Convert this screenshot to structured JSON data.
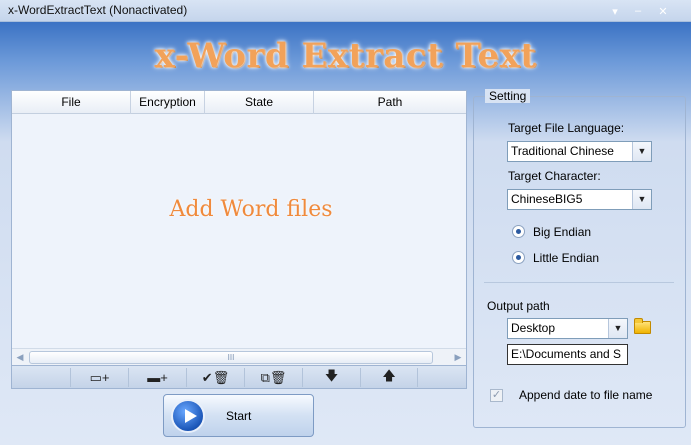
{
  "window": {
    "title": "x-WordExtractText",
    "activation": "(Nonactivated)"
  },
  "banner": "x-Word Extract Text",
  "file_list": {
    "columns": [
      "File",
      "Encryption",
      "State",
      "Path"
    ],
    "empty_hint": "Add Word files",
    "scroll_grip": "III"
  },
  "toolbar": {
    "buttons": [
      {
        "name": "add-file",
        "glyph": "▭+"
      },
      {
        "name": "add-folder",
        "glyph": "▬+"
      },
      {
        "name": "remove-checked",
        "glyph": "✔🗑"
      },
      {
        "name": "remove-all",
        "glyph": "⧉🗑"
      },
      {
        "name": "move-down",
        "glyph": "🡇"
      },
      {
        "name": "move-up",
        "glyph": "🡅"
      }
    ]
  },
  "start_button": {
    "label": "Start"
  },
  "settings": {
    "legend": "Setting",
    "language_label": "Target File Language:",
    "language_value": "Traditional Chinese",
    "character_label": "Target Character:",
    "character_value": "ChineseBIG5",
    "endian_options": [
      "Big Endian",
      "Little Endian"
    ],
    "output_label": "Output path",
    "output_select": "Desktop",
    "output_path": "E:\\Documents and S",
    "append_date_label": "Append date to file name",
    "append_date_checked": true
  },
  "colors": {
    "banner": "#f2a25a",
    "hint": "#f08a3c",
    "title_blue": "#3b72c4"
  }
}
